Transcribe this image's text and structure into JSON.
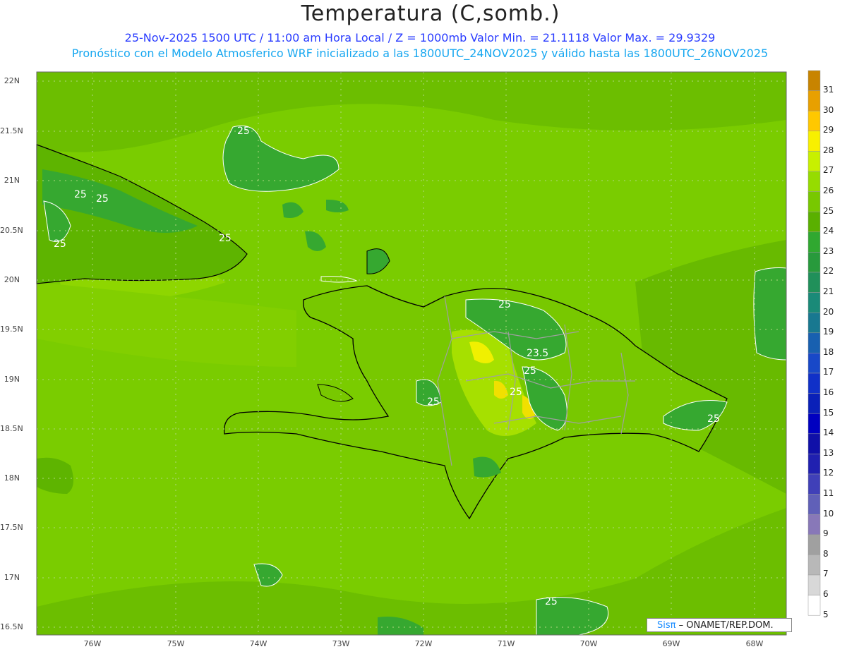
{
  "header": {
    "title": "Temperatura (C,somb.)",
    "line1": "25-Nov-2025 1500 UTC / 11:00 am Hora Local / Z = 1000mb   Valor Min. = 21.1118   Valor Max. = 29.9329",
    "line2": "Pronóstico con el Modelo Atmosferico WRF inicializado a las 1800UTC_24NOV2025 y válido hasta las  1800UTC_26NOV2025"
  },
  "axes": {
    "lat_labels": [
      "22N",
      "21.5N",
      "21N",
      "20.5N",
      "20N",
      "19.5N",
      "19N",
      "18.5N",
      "18N",
      "17.5N",
      "17N",
      "16.5N"
    ],
    "lon_labels": [
      "76W",
      "75W",
      "74W",
      "73W",
      "72W",
      "71W",
      "70W",
      "69W",
      "68W"
    ]
  },
  "colorbar": {
    "labels": [
      "31",
      "30",
      "29",
      "28",
      "27",
      "26",
      "25",
      "24",
      "23",
      "22",
      "21",
      "20",
      "19",
      "18",
      "17",
      "16",
      "15",
      "14",
      "13",
      "12",
      "11",
      "10",
      "9",
      "8",
      "7",
      "6",
      "5"
    ],
    "colors": [
      "#c88400",
      "#e8a000",
      "#ffc800",
      "#f8f000",
      "#c8f000",
      "#96dc00",
      "#78c800",
      "#5ab000",
      "#30a830",
      "#289a3c",
      "#20905a",
      "#1a8a78",
      "#187890",
      "#1860b0",
      "#1848c8",
      "#1030c8",
      "#0a20b8",
      "#0000c0",
      "#1010a8",
      "#2020b0",
      "#4040b8",
      "#6060b8",
      "#8878b8",
      "#a0a0a0",
      "#b8b8b8",
      "#d8d8d8",
      "#ffffff"
    ]
  },
  "contour_labels": [
    "25",
    "25",
    "25",
    "25",
    "25",
    "25",
    "25",
    "23.5",
    "25",
    "25",
    "25",
    "25",
    "25"
  ],
  "credit": {
    "sis": "Sisπ",
    "rest": "– ONAMET/REP.DOM."
  }
}
